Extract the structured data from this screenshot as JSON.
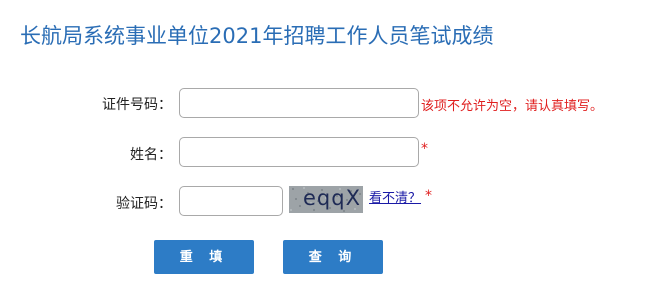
{
  "title": "长航局系统事业单位2021年招聘工作人员笔试成绩",
  "form": {
    "id_label": "证件号码：",
    "id_value": "",
    "id_error": "该项不允许为空，请认真填写。",
    "name_label": "姓名：",
    "name_value": "",
    "name_required": "*",
    "captcha_label": "验证码：",
    "captcha_value": "",
    "captcha_text": "eqqX",
    "refresh_link": "看不清？",
    "captcha_required": "*"
  },
  "buttons": {
    "reset_label": "重 填",
    "query_label": "查 询"
  },
  "colors": {
    "title": "#2a6db5",
    "button": "#2d7cc6",
    "error": "#e02020",
    "link": "#1a1aa6"
  }
}
